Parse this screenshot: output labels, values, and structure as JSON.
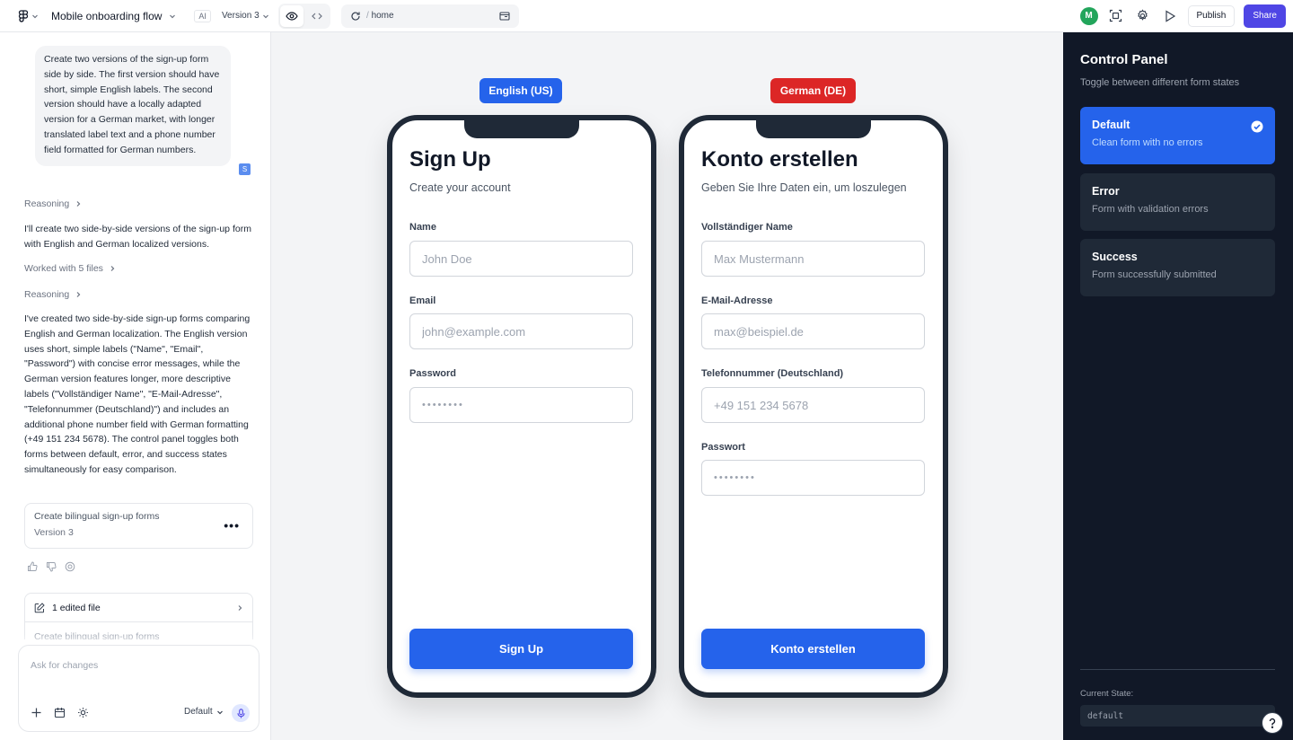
{
  "topbar": {
    "project_title": "Mobile onboarding flow",
    "ai_badge": "AI",
    "version_label": "Version 3",
    "url_path": "home",
    "avatar_initial": "M",
    "publish_label": "Publish",
    "share_label": "Share"
  },
  "chat": {
    "user_message": "Create two versions of the sign-up form side by side. The first version should have short, simple English labels. The second version should have a locally adapted version for a German market, with longer translated label text and a phone number field formatted for German numbers.",
    "user_tag": "S",
    "reasoning_label_1": "Reasoning",
    "response_1": "I'll create two side-by-side versions of the sign-up form with English and German localized versions.",
    "worked_files_label": "Worked with 5 files",
    "reasoning_label_2": "Reasoning",
    "response_2": "I've created two side-by-side sign-up forms comparing English and German localization. The English version uses short, simple labels (\"Name\", \"Email\", \"Password\") with concise error messages, while the German version features longer, more descriptive labels (\"Vollständiger Name\", \"E-Mail-Adresse\", \"Telefonnummer (Deutschland)\") and includes an additional phone number field with German formatting (+49 151 234 5678). The control panel toggles both forms between default, error, and success states simultaneously for easy comparison.",
    "version_card": {
      "title": "Create bilingual sign-up forms",
      "version": "Version 3",
      "more": "•••"
    },
    "edited_files_label": "1 edited file",
    "edited_file_title": "Create bilingual sign-up forms",
    "input_placeholder": "Ask for changes",
    "model_label": "Default"
  },
  "canvas": {
    "english": {
      "badge": "English (US)",
      "badge_color": "#2563eb",
      "title": "Sign Up",
      "subtitle": "Create your account",
      "fields": [
        {
          "label": "Name",
          "placeholder": "John Doe"
        },
        {
          "label": "Email",
          "placeholder": "john@example.com"
        },
        {
          "label": "Password",
          "placeholder": "••••••••"
        }
      ],
      "button": "Sign Up"
    },
    "german": {
      "badge": "German (DE)",
      "badge_color": "#dc2626",
      "title": "Konto erstellen",
      "subtitle": "Geben Sie Ihre Daten ein, um loszulegen",
      "fields": [
        {
          "label": "Vollständiger Name",
          "placeholder": "Max Mustermann"
        },
        {
          "label": "E-Mail-Adresse",
          "placeholder": "max@beispiel.de"
        },
        {
          "label": "Telefonnummer (Deutschland)",
          "placeholder": "+49 151 234 5678"
        },
        {
          "label": "Passwort",
          "placeholder": "••••••••"
        }
      ],
      "button": "Konto erstellen"
    }
  },
  "control_panel": {
    "title": "Control Panel",
    "subtitle": "Toggle between different form states",
    "states": [
      {
        "name": "Default",
        "description": "Clean form with no errors",
        "active": true
      },
      {
        "name": "Error",
        "description": "Form with validation errors",
        "active": false
      },
      {
        "name": "Success",
        "description": "Form successfully submitted",
        "active": false
      }
    ],
    "current_state_label": "Current State:",
    "current_state_value": "default",
    "accent_color": "#2563eb",
    "background_color": "#111827"
  }
}
